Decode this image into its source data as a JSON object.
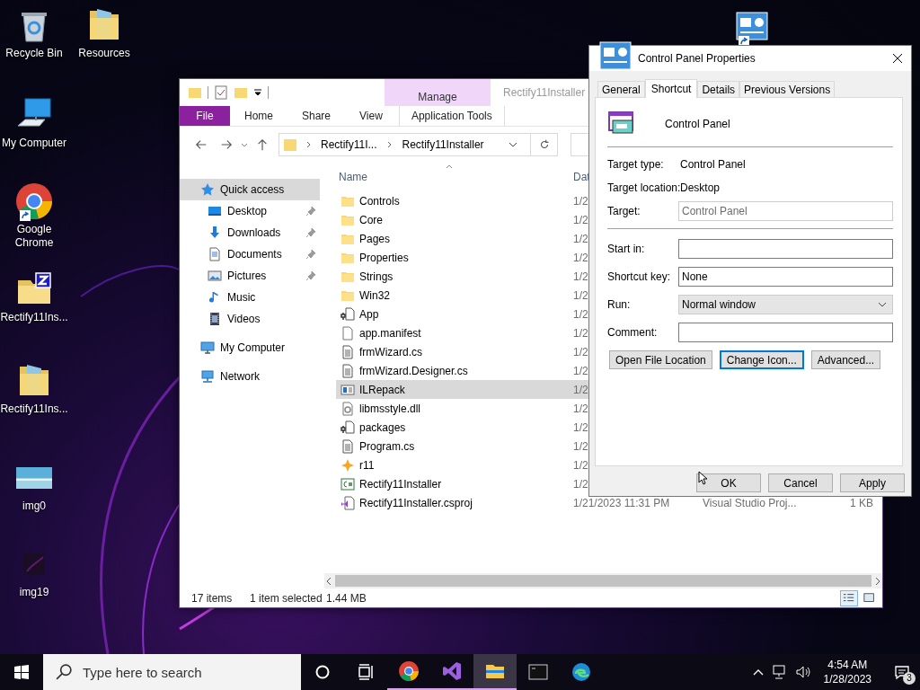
{
  "desktop": {
    "icons": [
      {
        "label": "Recycle Bin",
        "kind": "recycle-bin",
        "shortcut": false
      },
      {
        "label": "Resources",
        "kind": "doc-folder",
        "shortcut": false
      },
      {
        "label": "My Computer",
        "kind": "computer",
        "shortcut": false
      },
      {
        "label": "Google Chrome",
        "kind": "chrome",
        "shortcut": true
      },
      {
        "label": "Rectify11Ins...",
        "kind": "zip-folder",
        "shortcut": false
      },
      {
        "label": "Rectify11Ins...",
        "kind": "doc-folder",
        "shortcut": false
      },
      {
        "label": "img0",
        "kind": "image",
        "shortcut": false
      },
      {
        "label": "img19",
        "kind": "dark-image",
        "shortcut": false
      },
      {
        "kind": "control-panel",
        "shortcut": true
      }
    ]
  },
  "explorer": {
    "context_group": "Manage",
    "title": "Rectify11Installer",
    "ribbon_tabs": [
      {
        "label": "File",
        "kind": "file"
      },
      {
        "label": "Home",
        "kind": "plain"
      },
      {
        "label": "Share",
        "kind": "plain"
      },
      {
        "label": "View",
        "kind": "plain"
      },
      {
        "label": "Application Tools",
        "kind": "context"
      }
    ],
    "address": [
      "Rectify11I...",
      "Rectify11Installer"
    ],
    "navigation": [
      {
        "label": "Quick access",
        "kind": "star",
        "selected": true,
        "children": [
          {
            "label": "Desktop",
            "kind": "desktop",
            "pinned": true,
            "selected": false
          },
          {
            "label": "Downloads",
            "kind": "download",
            "pinned": true,
            "selected": false
          },
          {
            "label": "Documents",
            "kind": "document",
            "pinned": true,
            "selected": false
          },
          {
            "label": "Pictures",
            "kind": "picture",
            "pinned": true,
            "selected": false
          },
          {
            "label": "Music",
            "kind": "music",
            "pinned": false,
            "selected": false
          },
          {
            "label": "Videos",
            "kind": "video",
            "pinned": false,
            "selected": false
          }
        ]
      },
      {
        "label": "My Computer",
        "kind": "computer",
        "selected": false
      },
      {
        "label": "Network",
        "kind": "network",
        "selected": false
      }
    ],
    "columns": [
      {
        "label": "Name",
        "sorted": true
      },
      {
        "label": "Dat",
        "sorted": false
      }
    ],
    "files": [
      {
        "name": "Controls",
        "kind": "folder",
        "date": "1/2",
        "selected": false
      },
      {
        "name": "Core",
        "kind": "folder",
        "date": "1/2",
        "selected": false
      },
      {
        "name": "Pages",
        "kind": "folder",
        "date": "1/2",
        "selected": false
      },
      {
        "name": "Properties",
        "kind": "folder",
        "date": "1/2",
        "selected": false
      },
      {
        "name": "Strings",
        "kind": "folder",
        "date": "1/2",
        "selected": false
      },
      {
        "name": "Win32",
        "kind": "folder",
        "date": "1/2",
        "selected": false
      },
      {
        "name": "App",
        "kind": "resource",
        "date": "1/2",
        "selected": false
      },
      {
        "name": "app.manifest",
        "kind": "blank",
        "date": "1/2",
        "selected": false
      },
      {
        "name": "frmWizard.cs",
        "kind": "text",
        "date": "1/2",
        "selected": false
      },
      {
        "name": "frmWizard.Designer.cs",
        "kind": "text",
        "date": "1/2",
        "selected": false
      },
      {
        "name": "ILRepack",
        "kind": "window",
        "date": "1/2",
        "selected": true
      },
      {
        "name": "libmsstyle.dll",
        "kind": "gear",
        "date": "1/2",
        "selected": false
      },
      {
        "name": "packages",
        "kind": "resource",
        "date": "1/2",
        "selected": false
      },
      {
        "name": "Program.cs",
        "kind": "text",
        "date": "1/2",
        "selected": false
      },
      {
        "name": "r11",
        "kind": "sparkle",
        "date": "1/2",
        "selected": false
      },
      {
        "name": "Rectify11Installer",
        "kind": "csharp",
        "date": "1/2",
        "selected": false
      },
      {
        "name": "Rectify11Installer.csproj",
        "kind": "vs",
        "date": "1/21/2023 11:31 PM",
        "type": "Visual Studio Proj...",
        "size": "1 KB",
        "selected": false
      }
    ],
    "status": {
      "count": "17 items",
      "selection": "1 item selected",
      "size": "1.44 MB"
    },
    "view_buttons": [
      {
        "kind": "details",
        "selected": true
      },
      {
        "kind": "large-icons",
        "selected": false
      }
    ]
  },
  "properties_dialog": {
    "title": "Control Panel Properties",
    "tabs": [
      {
        "label": "General",
        "selected": false
      },
      {
        "label": "Shortcut",
        "selected": true
      },
      {
        "label": "Details",
        "selected": false
      },
      {
        "label": "Previous Versions",
        "selected": false
      }
    ],
    "item_name": "Control Panel",
    "sections": [
      [
        {
          "label": "Target type:",
          "kind": "text",
          "value": "Control Panel"
        },
        {
          "label": "Target location:",
          "kind": "text",
          "value": "Desktop"
        },
        {
          "label": "Target:",
          "kind": "field",
          "value": "Control Panel",
          "disabled": true
        }
      ],
      [
        {
          "label": "Start in:",
          "kind": "field",
          "disabled": false
        },
        {
          "label": "Shortcut key:",
          "kind": "field",
          "value": "None",
          "disabled": false
        },
        {
          "label": "Run:",
          "kind": "select",
          "value": "Normal window"
        },
        {
          "label": "Comment:",
          "kind": "field",
          "disabled": false
        }
      ]
    ],
    "actions": [
      {
        "label": "Open File Location",
        "focused": false
      },
      {
        "label": "Change Icon...",
        "focused": true
      },
      {
        "label": "Advanced...",
        "focused": false
      }
    ],
    "buttons": [
      {
        "label": "OK"
      },
      {
        "label": "Cancel"
      },
      {
        "label": "Apply"
      }
    ]
  },
  "taskbar": {
    "search_placeholder": "Type here to search",
    "apps": [
      {
        "kind": "chrome",
        "running": true,
        "active": false
      },
      {
        "kind": "visual-studio",
        "running": true,
        "active": false
      },
      {
        "kind": "file-explorer",
        "running": true,
        "active": true
      },
      {
        "kind": "terminal",
        "running": false,
        "active": false
      },
      {
        "kind": "edge",
        "running": false,
        "active": false
      }
    ],
    "time": "4:54 AM",
    "date": "1/28/2023",
    "notifications": "3"
  }
}
